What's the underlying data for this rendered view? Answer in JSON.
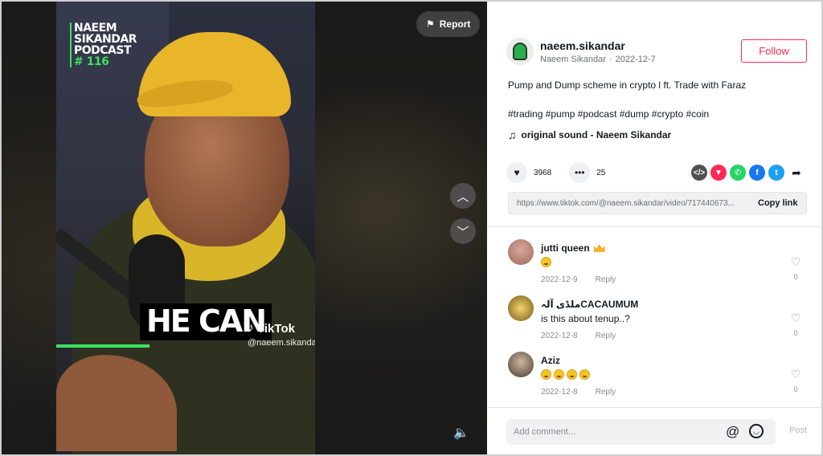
{
  "video": {
    "logo_lines": [
      "NAEEM",
      "SIKANDAR",
      "PODCAST"
    ],
    "episode": "# 116",
    "caption": "HE CAN",
    "watermark_brand": "TikTok",
    "watermark_handle": "@naeem.sikandar",
    "report_label": "Report",
    "progress": 0.36
  },
  "author": {
    "username": "naeem.sikandar",
    "display_name": "Naeem Sikandar",
    "date": "2022-12-7",
    "follow_label": "Follow"
  },
  "post": {
    "description": "Pump and Dump scheme in crypto l ft. Trade with Faraz",
    "hashtags": "#trading #pump #podcast #dump #crypto #coin",
    "sound": "original sound - Naeem Sikandar",
    "likes": "3968",
    "comments": "25",
    "link": "https://www.tiktok.com/@naeem.sikandar/video/717440673...",
    "copy_link_label": "Copy link"
  },
  "share_icons": [
    {
      "name": "embed-icon",
      "color": "#505050",
      "glyph": "</>"
    },
    {
      "name": "send-icon",
      "color": "#fe2c55",
      "glyph": "▼"
    },
    {
      "name": "whatsapp-icon",
      "color": "#25d366",
      "glyph": "✆"
    },
    {
      "name": "facebook-icon",
      "color": "#1877f2",
      "glyph": "f"
    },
    {
      "name": "twitter-icon",
      "color": "#1da1f2",
      "glyph": "t"
    }
  ],
  "comments": [
    {
      "user": "jutti queen",
      "text": "",
      "date": "2022-12-9",
      "reply": "Reply",
      "likes": "0",
      "badge": "crown",
      "emojis": 1
    },
    {
      "user": "ملڈی آلہCACAUMUM",
      "text": "is this about tenup..?",
      "date": "2022-12-8",
      "reply": "Reply",
      "likes": "0",
      "badge": "",
      "emojis": 0
    },
    {
      "user": "Aziz",
      "text": "",
      "date": "2022-12-8",
      "reply": "Reply",
      "likes": "0",
      "badge": "",
      "emojis": 4
    }
  ],
  "comment_box": {
    "placeholder": "Add comment...",
    "post_label": "Post"
  }
}
